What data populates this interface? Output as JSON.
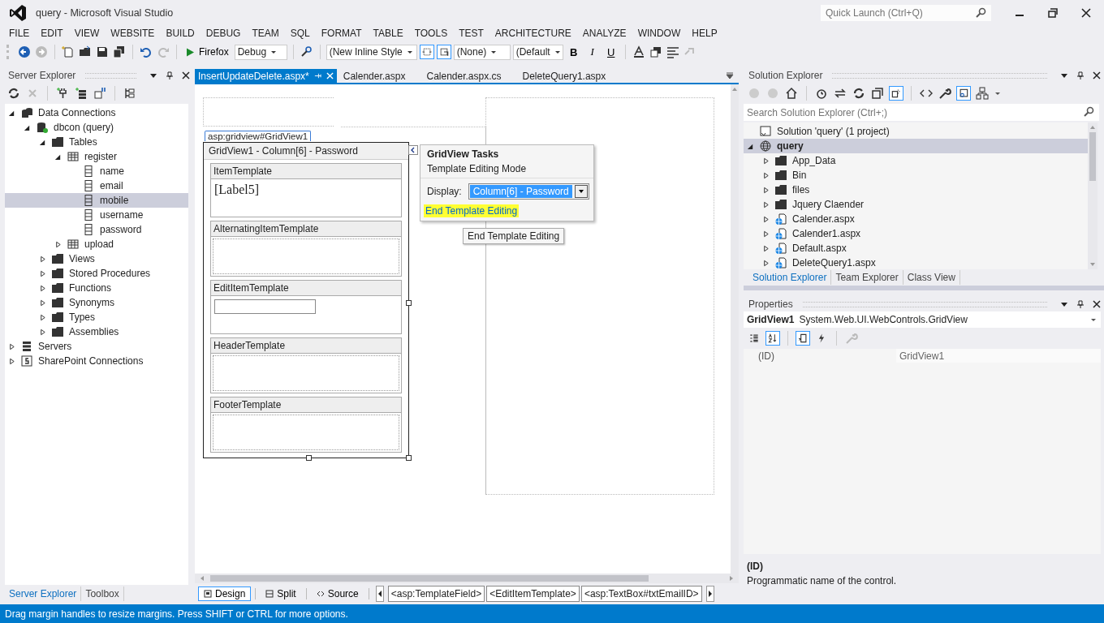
{
  "window": {
    "title": "query - Microsoft Visual Studio"
  },
  "quick_launch": {
    "placeholder": "Quick Launch (Ctrl+Q)"
  },
  "menu": [
    "FILE",
    "EDIT",
    "VIEW",
    "WEBSITE",
    "BUILD",
    "DEBUG",
    "TEAM",
    "SQL",
    "FORMAT",
    "TABLE",
    "TOOLS",
    "TEST",
    "ARCHITECTURE",
    "ANALYZE",
    "WINDOW",
    "HELP"
  ],
  "toolbar": {
    "run_target": "Firefox",
    "configuration": "Debug",
    "inline_style": "(New Inline Style",
    "target_rule": "(None)",
    "font": "(Default",
    "format_buttons": [
      "B",
      "I",
      "U"
    ],
    "toggles": [
      {
        "selected": true
      },
      {
        "selected": true
      }
    ]
  },
  "server_explorer": {
    "title": "Server Explorer",
    "tree": [
      {
        "label": "Data Connections",
        "kind": "connections",
        "expanded": true,
        "selected": false,
        "children": [
          {
            "label": "dbcon (query)",
            "kind": "database",
            "expanded": true,
            "selected": false,
            "children": [
              {
                "label": "Tables",
                "kind": "folder",
                "expanded": true,
                "selected": false,
                "children": [
                  {
                    "label": "register",
                    "kind": "table",
                    "expanded": true,
                    "selected": false,
                    "children": [
                      {
                        "label": "name",
                        "kind": "column",
                        "selected": false
                      },
                      {
                        "label": "email",
                        "kind": "column",
                        "selected": false
                      },
                      {
                        "label": "mobile",
                        "kind": "column",
                        "selected": true
                      },
                      {
                        "label": "username",
                        "kind": "column",
                        "selected": false
                      },
                      {
                        "label": "password",
                        "kind": "column",
                        "selected": false
                      }
                    ]
                  },
                  {
                    "label": "upload",
                    "kind": "table",
                    "expanded": false,
                    "selected": false
                  }
                ]
              },
              {
                "label": "Views",
                "kind": "folder",
                "expanded": false,
                "selected": false
              },
              {
                "label": "Stored Procedures",
                "kind": "folder",
                "expanded": false,
                "selected": false
              },
              {
                "label": "Functions",
                "kind": "folder",
                "expanded": false,
                "selected": false
              },
              {
                "label": "Synonyms",
                "kind": "folder",
                "expanded": false,
                "selected": false
              },
              {
                "label": "Types",
                "kind": "folder",
                "expanded": false,
                "selected": false
              },
              {
                "label": "Assemblies",
                "kind": "folder",
                "expanded": false,
                "selected": false
              }
            ]
          }
        ]
      },
      {
        "label": "Servers",
        "kind": "servers",
        "expanded": false,
        "selected": false
      },
      {
        "label": "SharePoint Connections",
        "kind": "sharepoint",
        "expanded": false,
        "selected": false
      }
    ]
  },
  "left_tabs": [
    {
      "label": "Server Explorer",
      "selected": true
    },
    {
      "label": "Toolbox",
      "selected": false
    }
  ],
  "document_tabs": [
    {
      "label": "InsertUpdateDelete.aspx*",
      "selected": true
    },
    {
      "label": "Calender.aspx",
      "selected": false
    },
    {
      "label": "Calender.aspx.cs",
      "selected": false
    },
    {
      "label": "DeleteQuery1.aspx",
      "selected": false
    }
  ],
  "designer": {
    "control_tag": "asp:gridview#GridView1",
    "grid_header": "GridView1 - Column[6] - Password",
    "templates": [
      {
        "title": "ItemTemplate",
        "kind": "label",
        "content": "[Label5]"
      },
      {
        "title": "AlternatingItemTemplate",
        "kind": "empty"
      },
      {
        "title": "EditItemTemplate",
        "kind": "textbox"
      },
      {
        "title": "HeaderTemplate",
        "kind": "empty"
      },
      {
        "title": "FooterTemplate",
        "kind": "empty"
      }
    ],
    "tasks": {
      "title": "GridView Tasks",
      "mode": "Template Editing Mode",
      "display_label": "Display:",
      "display_value": "Column[6] - Password",
      "link": "End Template Editing",
      "tooltip": "End Template Editing"
    }
  },
  "view_tabs": [
    {
      "label": "Design",
      "selected": true
    },
    {
      "label": "Split",
      "selected": false
    },
    {
      "label": "Source",
      "selected": false
    }
  ],
  "breadcrumbs": [
    "<asp:TemplateField>",
    "<EditItemTemplate>",
    "<asp:TextBox#txtEmailID>"
  ],
  "solution_explorer": {
    "title": "Solution Explorer",
    "search_placeholder": "Search Solution Explorer (Ctrl+;)",
    "tree": [
      {
        "label": "Solution 'query' (1 project)",
        "kind": "solution",
        "selected": false
      },
      {
        "label": "query",
        "kind": "project",
        "expanded": true,
        "selected": true,
        "children": [
          {
            "label": "App_Data",
            "kind": "folder",
            "expanded": false,
            "selected": false
          },
          {
            "label": "Bin",
            "kind": "folder",
            "expanded": false,
            "selected": false
          },
          {
            "label": "files",
            "kind": "folder",
            "expanded": false,
            "selected": false
          },
          {
            "label": "Jquery Claender",
            "kind": "folder",
            "expanded": false,
            "selected": false
          },
          {
            "label": "Calender.aspx",
            "kind": "page",
            "expanded": false,
            "selected": false
          },
          {
            "label": "Calender1.aspx",
            "kind": "page",
            "expanded": false,
            "selected": false
          },
          {
            "label": "Default.aspx",
            "kind": "page",
            "expanded": false,
            "selected": false
          },
          {
            "label": "DeleteQuery1.aspx",
            "kind": "page",
            "expanded": false,
            "selected": false
          }
        ]
      }
    ]
  },
  "right_tabs": [
    {
      "label": "Solution Explorer",
      "selected": true
    },
    {
      "label": "Team Explorer",
      "selected": false
    },
    {
      "label": "Class View",
      "selected": false
    }
  ],
  "properties": {
    "title": "Properties",
    "object_name": "GridView1",
    "object_type": "System.Web.UI.WebControls.GridView",
    "view_buttons": [
      {
        "kind": "categorized",
        "selected": false
      },
      {
        "kind": "alphabetical",
        "selected": true
      },
      {
        "kind": "properties",
        "selected": true
      },
      {
        "kind": "events",
        "selected": false
      }
    ],
    "rows": [
      {
        "name": "(ID)",
        "value": "GridView1"
      }
    ],
    "description_title": "(ID)",
    "description": "Programmatic name of the control."
  },
  "status_bar": {
    "text": "Drag margin handles to resize margins. Press SHIFT or CTRL for more options."
  }
}
